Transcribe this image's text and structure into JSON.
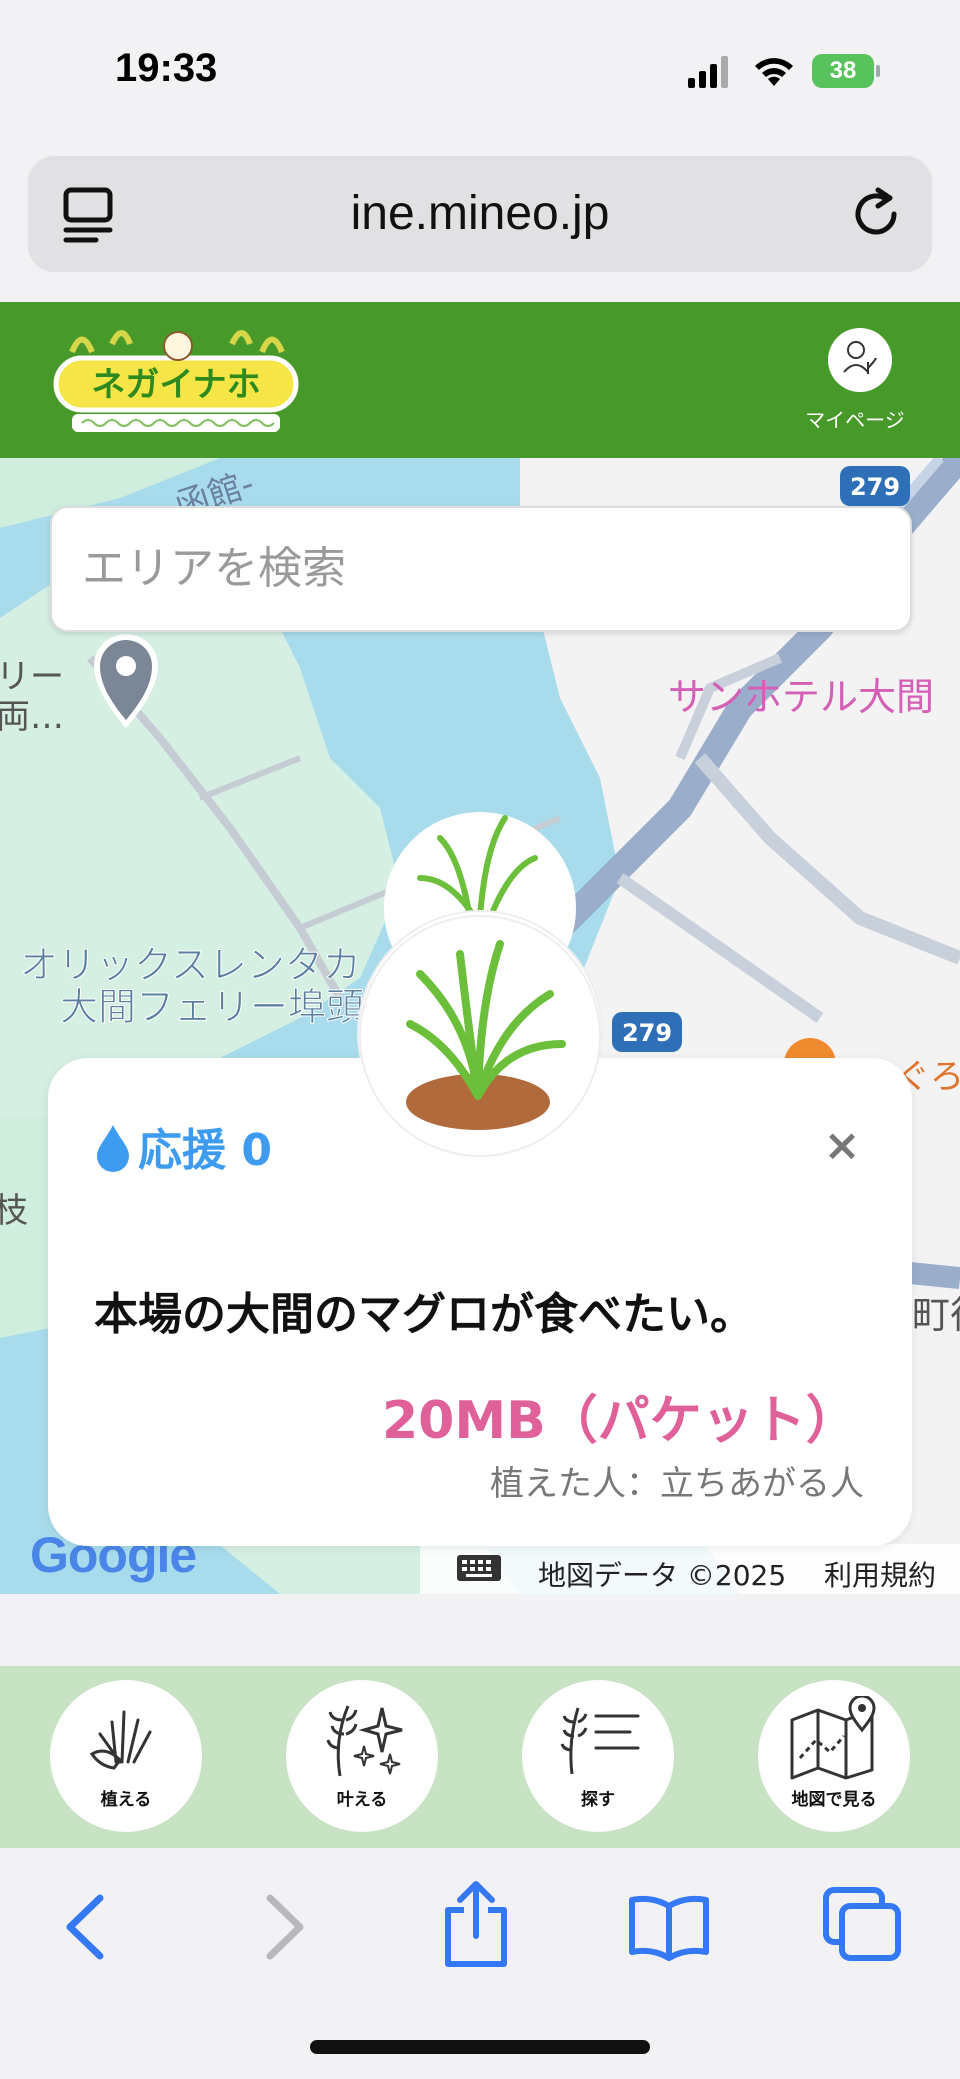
{
  "status_bar": {
    "time": "19:33",
    "battery": "38"
  },
  "browser": {
    "url": "ine.mineo.jp"
  },
  "header": {
    "mypage_label": "マイページ"
  },
  "map": {
    "search_placeholder": "エリアを検索",
    "labels": {
      "hotel": "サンホテル大間",
      "orix_line1": "オリックスレンタカ",
      "orix_line2": "大間フェリー埠頭",
      "ferry_line1": "リー",
      "ferry_line2": "両…",
      "route1": "279",
      "route2": "279",
      "edge_left": "枝",
      "edge_right": "町役",
      "edge_right_top": "ぐろ",
      "top_road": "函館-"
    },
    "google_logo": "Google",
    "attribution": "地図データ ©2025",
    "terms": "利用規約"
  },
  "card": {
    "support_label": "応援 0",
    "close_label": "×",
    "wish_text": "本場の大間のマグロが食べたい。",
    "reward": "20MB（パケット）",
    "planter": "植えた人：立ちあがる人"
  },
  "bottom_nav": [
    {
      "label": "植える",
      "icon": "plant-icon"
    },
    {
      "label": "叶える",
      "icon": "sparkle-icon"
    },
    {
      "label": "探す",
      "icon": "list-icon"
    },
    {
      "label": "地図で見る",
      "icon": "map-icon"
    }
  ],
  "colors": {
    "header_green": "#47992a",
    "nav_green": "#c7e3c4",
    "support_blue": "#3d9bf0",
    "reward_pink": "#e0609a",
    "safari_blue": "#3478f6"
  }
}
